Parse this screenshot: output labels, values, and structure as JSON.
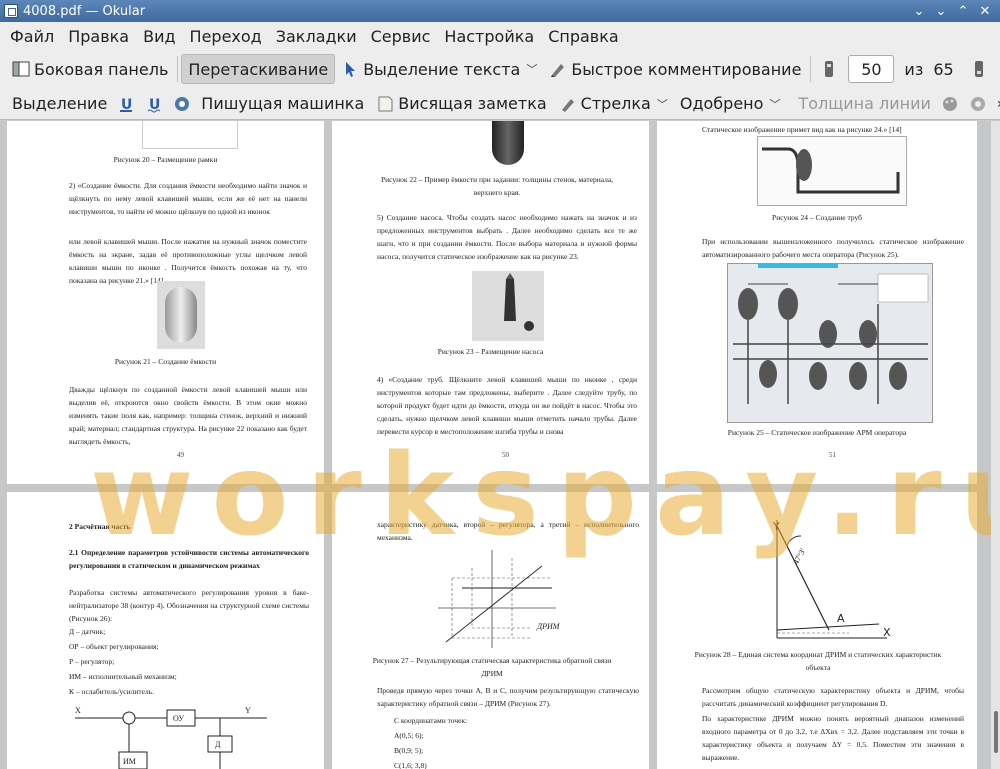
{
  "window": {
    "title": "4008.pdf  — Okular"
  },
  "menu": [
    "Файл",
    "Правка",
    "Вид",
    "Переход",
    "Закладки",
    "Сервис",
    "Настройка",
    "Справка"
  ],
  "toolbar1": {
    "sidebar": "Боковая панель",
    "drag": "Перетаскивание",
    "select_text": "Выделение текста",
    "quick_comment": "Быстрое комментирование",
    "page_current": "50",
    "page_of": "из",
    "page_total": "65"
  },
  "toolbar2": {
    "select": "Выделение",
    "typewriter": "Пишущая машинка",
    "sticky": "Висящая заметка",
    "arrow": "Стрелка",
    "approved": "Одобрено",
    "line_width": "Толщина линии"
  },
  "watermark": "workspay.ru",
  "p49": {
    "cap20": "Рисунок 20 – Размещение рамки",
    "t1": "2) «Создание ёмкости. Для создания ёмкости необходимо найти значок и щёлкнуть по нему левой клавишей мыши, если же её нет на панели инструментов, то найти её можно щёлкнув по одной из иконок",
    "t2": "или левой клавишей мыши. После нажатия на нужный значок поместите ёмкость на экране, задав её противоположные углы щелчком левой клавиши мыши по иконке . Получится ёмкость похожая на ту, что показана на рисунке 21.» [14]",
    "cap21": "Рисунок 21 – Создание ёмкости",
    "t3": "Дважды щёлкнув по созданной ёмкости левой клавишей мыши или выделив её, откроются окно свойств ёмкости. В этом окне можно изменять такие поля как, например: толщина стенок, верхний и нижний край; материал; стандартная структура. На рисунке 22 показано как будет выглядеть ёмкость,",
    "num": "49"
  },
  "p50": {
    "cap22": "Рисунок 22 – Пример ёмкости при задании: толщины стенок, материала, верхнего края.",
    "t1": "5) Создание насоса. Чтобы создать насос необходимо нажать на значок и из предложенных инструментов выбрать . Далее необходимо сделать все те же шаги, что и при создании ёмкости. После выбора материала и нужной формы насоса, получится статическое изображение как на рисунке 23.",
    "cap23": "Рисунок 23 – Размещение насоса",
    "t2": "4) «Создание труб. Щёлкните левой клавишей мыши по иконке , среди инструментов которые там предложены, выберите . Далее следуйте трубу, по которой продукт будет идти до ёмкости, откуда он же пойдёт в насос. Чтобы это сделать, нужно щелчком левой клавиши мыши отметить начало трубы. Далее перевести курсор в местоположение изгиба трубы и снова",
    "num": "50"
  },
  "p51": {
    "t0": "Статическое изображение примет вид как на рисунке 24.» [14]",
    "cap24": "Рисунок 24 – Создание труб",
    "t1": "При использовании вышеизложенного получилось статическое изображение автоматизированного рабочего места оператора (Рисунок 25).",
    "cap25": "Рисунок 25 – Статическое изображение АРМ оператора",
    "num": "51"
  },
  "p52": {
    "h1": "2 Расчётная часть",
    "h2": "2.1 Определение параметров устойчивости системы автоматического регулирования в статическом и динамическом режимах",
    "t1": "Разработка системы автоматического регулирования уровня в баке-нейтрализаторе 38 (контур 4). Обозначения на структурной схеме системы (Рисунок 26):",
    "l1": "Д – датчик;",
    "l2": "ОР – объект регулирования;",
    "l3": "Р – регулятор;",
    "l4": "ИМ – исполнительный механизм;",
    "l5": "К – ослабитель/усилитель.",
    "x": "X",
    "y": "Y",
    "ou": "ОУ",
    "d": "Д",
    "im": "ИМ"
  },
  "p53": {
    "t0": "характеристику датчика, второй – регулятора, а третий – исполнительного механизма.",
    "drim": "ДРИМ",
    "cap27": "Рисунок 27 – Результирующая статическая характеристика обратной связи ДРИМ",
    "t1": "Проведя прямую через точки А, В и С, получим результирующую статическую характеристику обратной связи – ДРИМ (Рисунок 27).",
    "t2": "С координатами точек:",
    "a": "А(0,5; 6);",
    "b": "В(0,9; 5);",
    "c": "С(1,6; 3,8)"
  },
  "p54": {
    "y": "Y",
    "x": "X",
    "a": "A",
    "angle": "47°3'",
    "cap28": "Рисунок 28 – Единая система координат ДРИМ и статических характеристик объекта",
    "t1": "Рассмотрим общую статическую характеристику объекта и ДРИМ, чтобы рассчитать динамический коэффициент регулирования D.",
    "t2": "По характеристике ДРИМ можно понять вероятный диапазон изменений входного параметра от 0 до 3,2, т.е ΔXвх = 3,2. Далее подставляем эти точки в характеристику объекта и получаем ΔY = 0,5. Поместим эти значения в выражение."
  }
}
